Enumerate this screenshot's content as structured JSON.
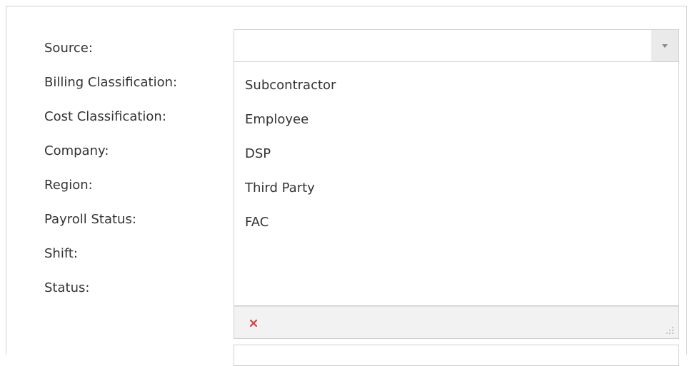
{
  "form": {
    "labels": [
      "Source:",
      "Billing Classification:",
      "Cost Classification:",
      "Company:",
      "Region:",
      "Payroll Status:",
      "Shift:",
      "Status:"
    ]
  },
  "source_dropdown": {
    "value": "",
    "arrow_icon": "chevron-down-icon",
    "options": [
      "Subcontractor",
      "Employee",
      "DSP",
      "Third Party",
      "FAC"
    ],
    "clear_icon": "close-icon",
    "clear_color": "#e03b3b",
    "grip_icon": "resize-grip-icon"
  }
}
